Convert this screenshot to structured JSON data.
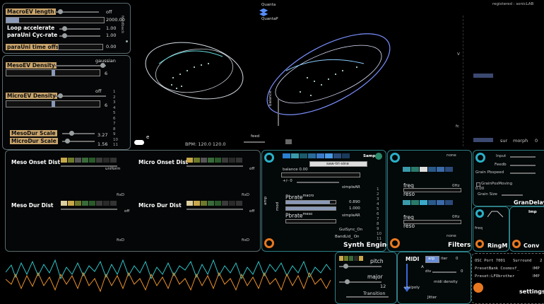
{
  "top_right": {
    "registered": "registered : sonicLAB"
  },
  "macro": {
    "macroev_length": "MacroEV length",
    "off": "off",
    "value_2000": "2000.00",
    "loop_accelerate": "Loop accelerate",
    "loop_value": "1.00",
    "parauni_cycrate": "paraUni Cyc-rate",
    "cycrate_value": "1.00",
    "parauni_time_offset": "paraUni time offset",
    "offset_value": "0.00",
    "feedback": "feedback"
  },
  "meso": {
    "mesoev_density": "MesoEV Density",
    "gaussian": "gaussian",
    "six_a": "6",
    "microev_density": "MicroEV Density",
    "off": "off",
    "six_b": "6",
    "scale_numbers": [
      "1",
      "2",
      "3",
      "4",
      "5",
      "6",
      "7",
      "8",
      "9",
      "10",
      "11"
    ],
    "mesodur_scale": "MesoDur Scale",
    "mesodur_value": "3.27",
    "microdur_scale": "MicroDur Scale",
    "microdur_value": "1.56"
  },
  "quanta": {
    "quanta": "Quanta",
    "quantap": "QuantaP"
  },
  "viz": {
    "bpm": "BPM: 120.0 120.0",
    "feed": "feed",
    "balance": "balance",
    "e_label": "e"
  },
  "dist": {
    "meso_onset": "Meso Onset Dist",
    "uniform": "uniform",
    "micro_onset": "Micro Onset Dist",
    "off1": "off",
    "fixd1": "fixD",
    "fixd2": "fixD",
    "meso_dur": "Meso Dur Dist",
    "off2": "off",
    "micro_dur": "Micro Dur Dist",
    "off3": "off",
    "fixd3": "fixD",
    "fixd4": "fixD"
  },
  "synth": {
    "samp": "Samp",
    "saw_tri_sine": "saw-tri-sine",
    "balance": "balance 0.00",
    "plus_minus": "+/- 0",
    "simplear1": "simpleAR",
    "pbrate_macro": "Pbrate",
    "macro_sup": "macro",
    "val_0890": "0.890",
    "val_1000": "1.000",
    "pbrate_meso": "Pbrate",
    "meso_sup": "meso",
    "simplear2": "simpleAR",
    "gusync": "GuiSync_On",
    "bandlid": "BandLid_ On",
    "amp": "amp",
    "mod": "mod",
    "numbers": [
      "1",
      "2",
      "3",
      "4",
      "5",
      "6",
      "7",
      "8",
      "9",
      "10",
      "11"
    ],
    "title": "Synth Engine"
  },
  "filters": {
    "none1": "none",
    "freq1": "freq",
    "zero_hz1": "0Hz",
    "reso1": "reso",
    "freq2": "freq",
    "zero_hz2": "0Hz",
    "reso2": "reso",
    "none2": "none",
    "title": "Filters"
  },
  "graindelay": {
    "input": "Input",
    "feedb": "Feedb",
    "grain_pbspeed": "Grain Pbspeed",
    "grain_pos_moving": "GrainPosMoving",
    "grain_size": "Grain Size",
    "val_000": "0.00",
    "title": "GranDelay"
  },
  "ringm": {
    "freq": "freq",
    "title": "RingM"
  },
  "conv": {
    "imp": "Imp",
    "title": "Conv"
  },
  "pitch": {
    "pitch": "pitch",
    "major": "major",
    "twelve": "12",
    "transition": "Transition"
  },
  "midi": {
    "midi": "MIDI",
    "arp": "arp",
    "iter": "iter",
    "zero1": "0",
    "a": "A",
    "div": "div",
    "zero2": "0",
    "midi_density": "midi density",
    "uni_poly": "uni/poly",
    "jitter": "Jitter"
  },
  "settings": {
    "osc_port": "OSC Port 7001",
    "surround": "Surround",
    "two": "2",
    "preset_bank": "PresetBank Cosmosf_",
    "imp1": "IMP",
    "preset": "Preset:LFObrother",
    "imp2": "IMP",
    "title": "settings"
  },
  "right_scope": {
    "v_label": "V",
    "fc_label": "fc",
    "sur": "sur",
    "morph": "morph",
    "zero": "0"
  }
}
